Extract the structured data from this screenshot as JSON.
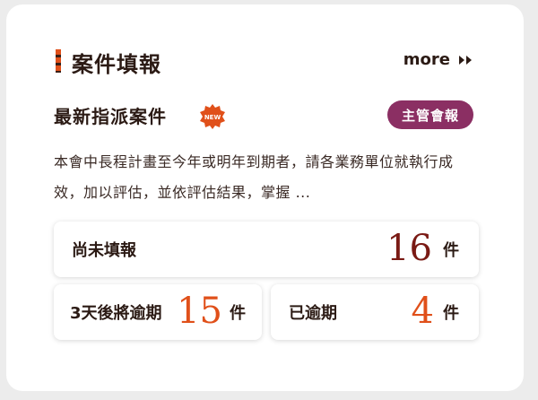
{
  "panel": {
    "title": "案件填報",
    "more_label": "more"
  },
  "latest": {
    "title": "最新指派案件",
    "new_badge": "NEW",
    "tag_label": "主管會報",
    "description": "本會中長程計畫至今年或明年到期者，請各業務單位就執行成效，加以評估，並依評估結果，掌握 ..."
  },
  "stats": {
    "unfilled": {
      "label": "尚未填報",
      "value": "16",
      "unit": "件"
    },
    "due_soon": {
      "label": "3天後將逾期",
      "value": "15",
      "unit": "件"
    },
    "overdue": {
      "label": "已逾期",
      "value": "4",
      "unit": "件"
    }
  },
  "colors": {
    "accent_orange": "#e0501a",
    "dark_red": "#7a1a14",
    "tag_purple": "#8b2f63"
  }
}
